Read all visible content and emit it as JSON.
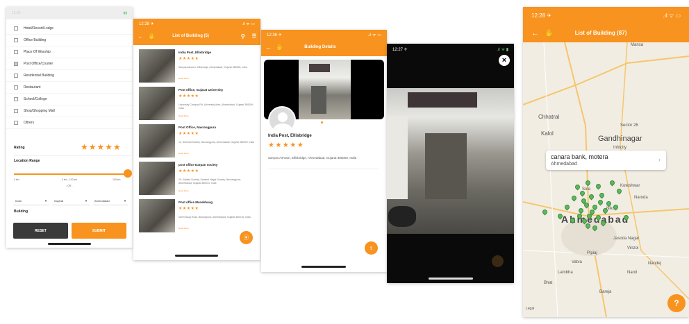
{
  "filter_screen": {
    "building_types": [
      {
        "label": "Hotel/Resort/Lodge",
        "checked": false
      },
      {
        "label": "Office Building",
        "checked": false
      },
      {
        "label": "Place Of Worship",
        "checked": false
      },
      {
        "label": "Post Office/Courier",
        "checked": true
      },
      {
        "label": "Residential Building",
        "checked": false
      },
      {
        "label": "Restaurant",
        "checked": false
      },
      {
        "label": "School/College",
        "checked": false
      },
      {
        "label": "Shop/Shopping Mall",
        "checked": false
      },
      {
        "label": "Others",
        "checked": false
      }
    ],
    "rating_label": "Rating",
    "location_range_label": "Location Range",
    "range_min": "0 km",
    "range_mid": "0 km - 100 km",
    "range_max": "100 km",
    "or_text": "- OR -",
    "country": "India",
    "state": "Gujarat",
    "city": "Ahmedabad",
    "building_label": "Building",
    "reset_label": "RESET",
    "submit_label": "SUBMIT"
  },
  "list_screen": {
    "time": "12:28 ✈",
    "title": "List of Building (5)",
    "read_more": "Read More",
    "items": [
      {
        "title": "India Post, Ellisbridge",
        "address": "Sanyas Ashram, Ellisbridge, Ahmedabad, Gujarat 380006, India"
      },
      {
        "title": "Post office, Gujarat University",
        "address": "University Campus Rd, University Area, Ahmedabad, Gujarat 380009, India"
      },
      {
        "title": "Post Office, Navrangpura",
        "address": "14, Shrimali Society, Navrangpura, Ahmedabad, Gujarat 380009, India"
      },
      {
        "title": "post office Darpan society",
        "address": "29, Kailash Society, Sanskrit Nagar Society, Navrangpura, Ahmedabad, Gujarat 380014, India"
      },
      {
        "title": "Post office  Manekbaug",
        "address": "North Baug Road, Bhudarpura, Ahmedabad, Gujarat 380015, India"
      }
    ]
  },
  "details_screen": {
    "time": "12:36 ✈",
    "title": "Building Details",
    "building_name": "India Post, Ellisbridge",
    "address": "Sanyas Ashram, Ellisbridge, Ahmedabad, Gujarat 380006, India"
  },
  "photo_screen": {
    "time": "12:27 ✈"
  },
  "map_screen": {
    "time": "12:28 ✈",
    "title": "List of Building (87)",
    "popup_title": "canara bank, motera",
    "popup_subtitle": "Ahmedabad",
    "places": [
      "Mansa",
      "Chhatral",
      "Kalol",
      "Gandhinagar",
      "Sector 26",
      "Infocity",
      "Sola",
      "Koteshwar",
      "Naroda",
      "Ahmedabad",
      "Vatva",
      "Narol",
      "Bhat",
      "Bareja",
      "Lambha",
      "Pipiaj",
      "Jasoda Nagar",
      "Nikol",
      "Vinzol",
      "Nandej"
    ],
    "logo": "Legal",
    "help": "?"
  },
  "colors": {
    "accent": "#f7931e",
    "pin": "#5cb85c"
  }
}
